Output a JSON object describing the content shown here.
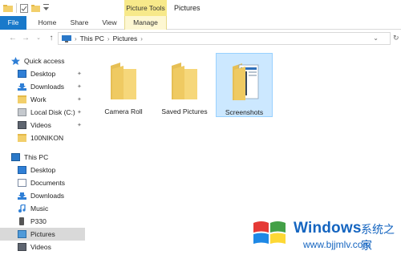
{
  "title_bar": {
    "context_tab": "Picture Tools",
    "window_title": "Pictures"
  },
  "ribbon": {
    "tabs": [
      "File",
      "Home",
      "Share",
      "View",
      "Manage"
    ],
    "accent": "#1979ca",
    "context_color": "#f7e98a"
  },
  "address": {
    "crumbs": [
      "This PC",
      "Pictures"
    ]
  },
  "sidebar": {
    "quick_access": "Quick access",
    "quick_items": [
      {
        "label": "Desktop",
        "icon": "desktop-icon",
        "pinned": true
      },
      {
        "label": "Downloads",
        "icon": "downloads-icon",
        "pinned": true
      },
      {
        "label": "Work",
        "icon": "folder-icon",
        "pinned": true
      },
      {
        "label": "Local Disk (C:)",
        "icon": "drive-icon",
        "pinned": true
      },
      {
        "label": "Videos",
        "icon": "videos-icon",
        "pinned": true
      },
      {
        "label": "100NIKON",
        "icon": "folder-icon",
        "pinned": false
      }
    ],
    "this_pc": "This PC",
    "pc_items": [
      {
        "label": "Desktop",
        "icon": "desktop-icon"
      },
      {
        "label": "Documents",
        "icon": "documents-icon"
      },
      {
        "label": "Downloads",
        "icon": "downloads-icon"
      },
      {
        "label": "Music",
        "icon": "music-icon"
      },
      {
        "label": "P330",
        "icon": "phone-icon"
      },
      {
        "label": "Pictures",
        "icon": "pictures-icon",
        "selected": true
      },
      {
        "label": "Videos",
        "icon": "videos-icon"
      }
    ]
  },
  "content": {
    "folders": [
      {
        "label": "Camera Roll",
        "selected": false
      },
      {
        "label": "Saved Pictures",
        "selected": false
      },
      {
        "label": "Screenshots",
        "selected": true
      }
    ]
  },
  "watermark": {
    "brand": "Windows",
    "cn": "系统之家",
    "url": "www.bjjmlv.com"
  }
}
